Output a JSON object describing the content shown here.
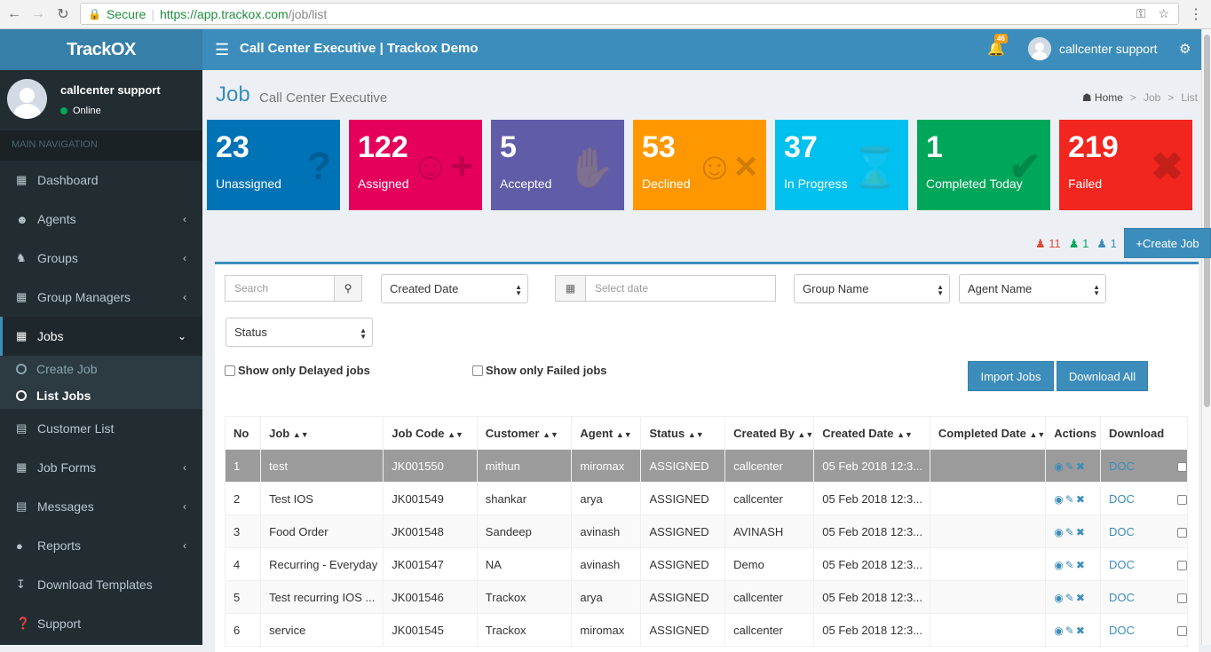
{
  "browser": {
    "secure_label": "Secure",
    "url_host": "https://app.trackox.com",
    "url_path": "/job/list"
  },
  "brand": {
    "name": "TrackOX"
  },
  "topbar": {
    "title": "Call Center Executive | Trackox Demo",
    "notification_count": "46",
    "username": "callcenter support"
  },
  "sidebar": {
    "user_name": "callcenter support",
    "user_status": "Online",
    "nav_header": "MAIN NAVIGATION",
    "items": [
      {
        "label": "Dashboard",
        "icon": "dashboard-icon"
      },
      {
        "label": "Agents",
        "icon": "users-icon"
      },
      {
        "label": "Groups",
        "icon": "group-icon"
      },
      {
        "label": "Group Managers",
        "icon": "manager-icon"
      },
      {
        "label": "Jobs",
        "icon": "jobs-icon"
      },
      {
        "label": "Customer List",
        "icon": "customer-icon"
      },
      {
        "label": "Job Forms",
        "icon": "forms-icon"
      },
      {
        "label": "Messages",
        "icon": "messages-icon"
      },
      {
        "label": "Reports",
        "icon": "reports-icon"
      },
      {
        "label": "Download Templates",
        "icon": "download-icon"
      },
      {
        "label": "Support",
        "icon": "support-icon"
      }
    ],
    "jobs_sub": [
      "Create Job",
      "List Jobs"
    ]
  },
  "page": {
    "title": "Job",
    "subtitle": "Call Center Executive",
    "breadcrumb": [
      "Home",
      "Job",
      "List"
    ]
  },
  "tiles": [
    {
      "num": "23",
      "label": "Unassigned",
      "color": "#0073b7"
    },
    {
      "num": "122",
      "label": "Assigned",
      "color": "#e5005c"
    },
    {
      "num": "5",
      "label": "Accepted",
      "color": "#605ca8"
    },
    {
      "num": "53",
      "label": "Declined",
      "color": "#ff9800"
    },
    {
      "num": "37",
      "label": "In Progress",
      "color": "#00c0ef"
    },
    {
      "num": "1",
      "label": "Completed Today",
      "color": "#00a65a"
    },
    {
      "num": "219",
      "label": "Failed",
      "color": "#f0261f"
    }
  ],
  "stats": {
    "red": "11",
    "green": "1",
    "blue": "1"
  },
  "create_job_label": "+Create Job",
  "filters": {
    "search_placeholder": "Search",
    "created_date": "Created Date",
    "date_placeholder": "Select date",
    "group_name": "Group Name",
    "agent_name": "Agent Name",
    "status": "Status",
    "delayed_label": "Show only Delayed jobs",
    "failed_label": "Show only Failed jobs",
    "import_label": "Import Jobs",
    "download_all_label": "Download All"
  },
  "table": {
    "headers": [
      "No",
      "Job",
      "Job Code",
      "Customer",
      "Agent",
      "Status",
      "Created By",
      "Created Date",
      "Completed Date",
      "Actions",
      "Download"
    ],
    "doc_label": "DOC",
    "rows": [
      [
        "1",
        "test",
        "JK001550",
        "mithun",
        "miromax",
        "ASSIGNED",
        "callcenter",
        "05 Feb 2018 12:3...",
        ""
      ],
      [
        "2",
        "Test IOS",
        "JK001549",
        "shankar",
        "arya",
        "ASSIGNED",
        "callcenter",
        "05 Feb 2018 12:3...",
        ""
      ],
      [
        "3",
        "Food Order",
        "JK001548",
        "Sandeep",
        "avinash",
        "ASSIGNED",
        "AVINASH",
        "05 Feb 2018 12:3...",
        ""
      ],
      [
        "4",
        "Recurring - Everyday",
        "JK001547",
        "NA",
        "avinash",
        "ASSIGNED",
        "Demo",
        "05 Feb 2018 12:3...",
        ""
      ],
      [
        "5",
        "Test recurring IOS ...",
        "JK001546",
        "Trackox",
        "arya",
        "ASSIGNED",
        "callcenter",
        "05 Feb 2018 12:3...",
        ""
      ],
      [
        "6",
        "service",
        "JK001545",
        "Trackox",
        "miromax",
        "ASSIGNED",
        "callcenter",
        "05 Feb 2018 12:3...",
        ""
      ]
    ]
  }
}
